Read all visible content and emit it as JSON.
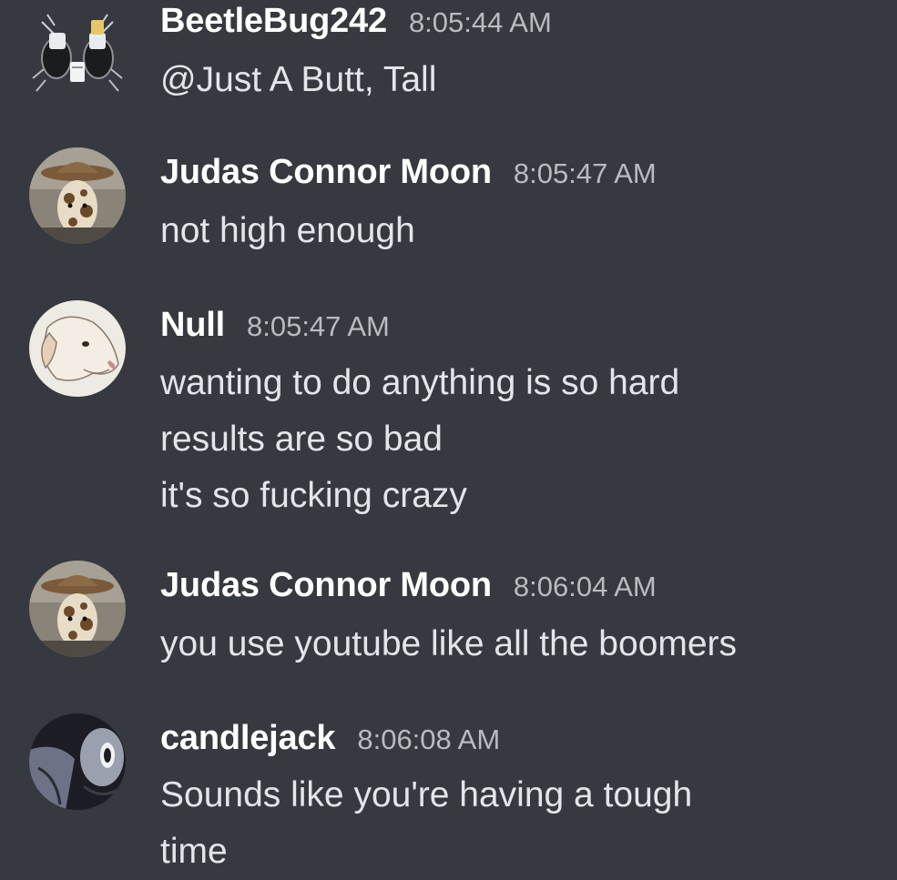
{
  "colors": {
    "background": "#36393f",
    "username": "#ffffff",
    "timestamp": "#b9bbbe",
    "text": "#e3e5e8"
  },
  "messages": [
    {
      "author": "BeetleBug242",
      "time": "8:05:44 AM",
      "avatar_icon": "bug-mugs-avatar-icon",
      "lines": [
        "@Just A Butt, Tall"
      ]
    },
    {
      "author": "Judas Connor Moon",
      "time": "8:05:47 AM",
      "avatar_icon": "giraffe-cowboy-avatar-icon",
      "lines": [
        "not high enough"
      ]
    },
    {
      "author": "Null",
      "time": "8:05:47 AM",
      "avatar_icon": "dog-avatar-icon",
      "lines": [
        "wanting to do anything is so hard",
        "results are so bad",
        "it's so fucking crazy"
      ]
    },
    {
      "author": "Judas Connor Moon",
      "time": "8:06:04 AM",
      "avatar_icon": "giraffe-cowboy-avatar-icon",
      "lines": [
        "you use youtube like all the boomers"
      ]
    },
    {
      "author": "candlejack",
      "time": "8:06:08 AM",
      "avatar_icon": "robot-avatar-icon",
      "lines": [
        "Sounds like you're having a tough",
        "time"
      ]
    }
  ]
}
